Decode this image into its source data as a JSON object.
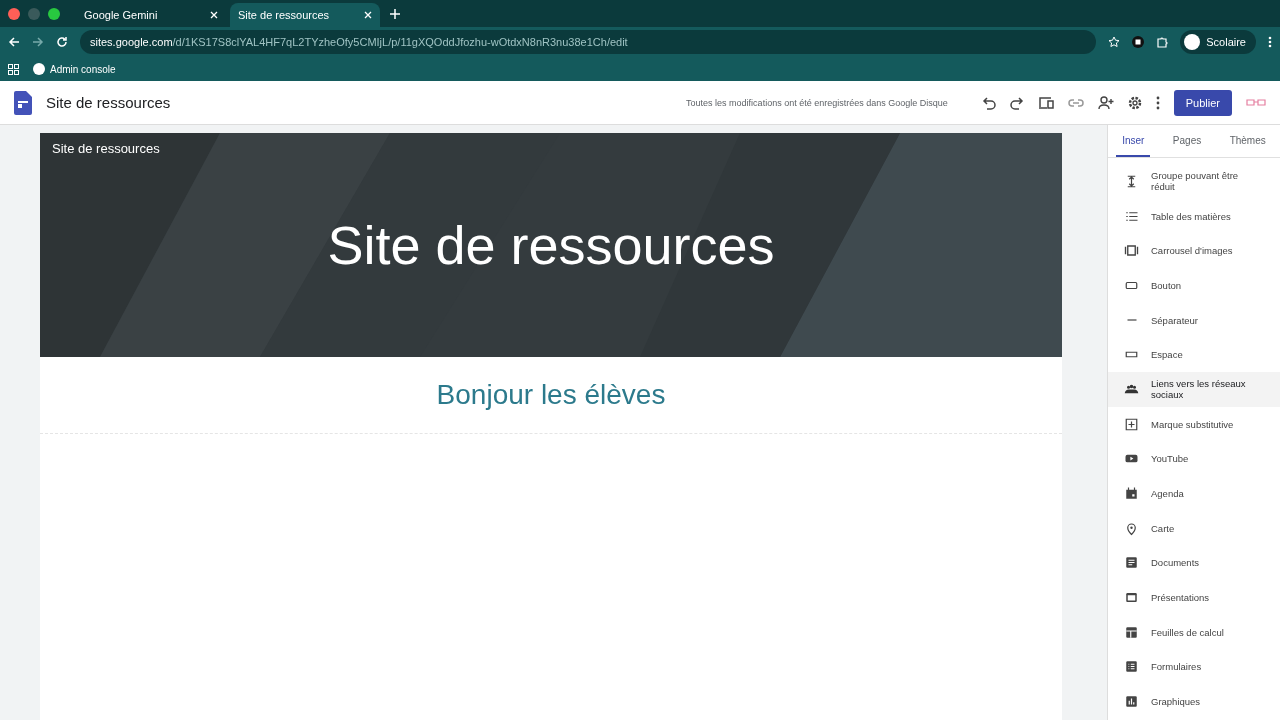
{
  "browser": {
    "tabs": [
      {
        "title": "Google Gemini",
        "selected": false
      },
      {
        "title": "Site de ressources",
        "selected": true
      }
    ],
    "url_host": "sites.google.com",
    "url_path": "/d/1KS17S8clYAL4HF7qL2TYzheOfy5CMIjL/p/11gXQOddJfozhu-wOtdxN8nR3nu38e1Ch/edit",
    "profile": "Scolaire",
    "bookmarks": [
      "Admin console"
    ]
  },
  "app": {
    "title": "Site de ressources",
    "save_status": "Toutes les modifications ont été enregistrées dans Google Disque",
    "publish": "Publier"
  },
  "page": {
    "site_name": "Site de ressources",
    "banner_title": "Site de ressources",
    "heading": "Bonjour les élèves"
  },
  "sidebar": {
    "tabs": [
      {
        "label": "Inser",
        "selected": true
      },
      {
        "label": "Pages",
        "selected": false
      },
      {
        "label": "Thèmes",
        "selected": false
      }
    ],
    "items": [
      {
        "label": "Groupe pouvant être réduit",
        "selected": false
      },
      {
        "label": "Table des matières",
        "selected": false
      },
      {
        "label": "Carrousel d'images",
        "selected": false
      },
      {
        "label": "Bouton",
        "selected": false
      },
      {
        "label": "Séparateur",
        "selected": false
      },
      {
        "label": "Espace",
        "selected": false
      },
      {
        "label": "Liens vers les réseaux sociaux",
        "selected": true
      },
      {
        "label": "Marque substitutive",
        "selected": false
      },
      {
        "label": "YouTube",
        "selected": false
      },
      {
        "label": "Agenda",
        "selected": false
      },
      {
        "label": "Carte",
        "selected": false
      },
      {
        "label": "Documents",
        "selected": false
      },
      {
        "label": "Présentations",
        "selected": false
      },
      {
        "label": "Feuilles de calcul",
        "selected": false
      },
      {
        "label": "Formulaires",
        "selected": false
      },
      {
        "label": "Graphiques",
        "selected": false
      }
    ]
  }
}
